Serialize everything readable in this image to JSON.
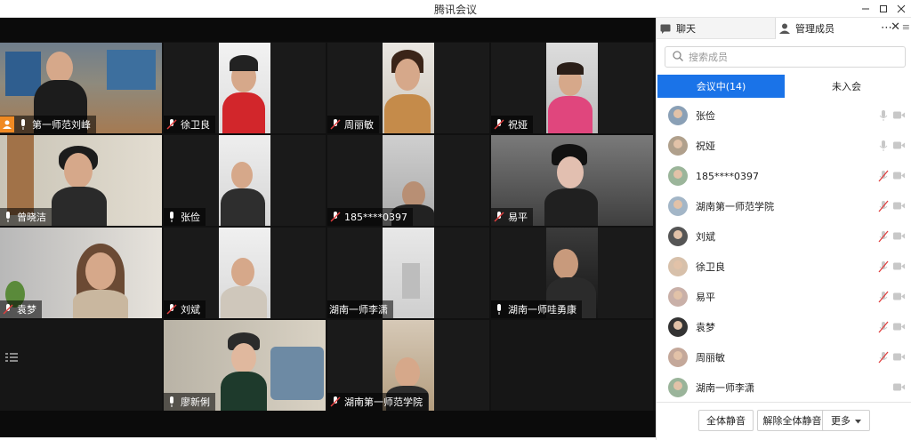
{
  "window": {
    "title": "腾讯会议"
  },
  "video_grid": {
    "tiles": [
      {
        "name": "第一师范刘峰",
        "host": true,
        "mic": "on"
      },
      {
        "name": "徐卫良",
        "mic": "muted"
      },
      {
        "name": "周丽敏",
        "mic": "muted"
      },
      {
        "name": "祝娅",
        "mic": "muted"
      },
      {
        "name": "曾晓洁",
        "mic": "on"
      },
      {
        "name": "张俭",
        "mic": "on"
      },
      {
        "name": "185****0397",
        "mic": "muted"
      },
      {
        "name": "易平",
        "mic": "muted"
      },
      {
        "name": "袁梦",
        "mic": "muted"
      },
      {
        "name": "刘斌",
        "mic": "muted"
      },
      {
        "name": "湖南一师李潇",
        "mic": "none"
      },
      {
        "name": "湖南一师哇勇康",
        "mic": "on"
      },
      {
        "name": "廖新俐",
        "mic": "on"
      },
      {
        "name": "湖南第一师范学院",
        "mic": "muted"
      }
    ]
  },
  "panel": {
    "tabs": {
      "chat": "聊天",
      "members": "管理成员"
    },
    "search_placeholder": "搜索成员",
    "segments": {
      "in_meeting": "会议中(14)",
      "not_joined": "未入会"
    },
    "members": [
      {
        "name": "张俭",
        "mic": "on"
      },
      {
        "name": "祝娅",
        "mic": "on"
      },
      {
        "name": "185****0397",
        "mic": "muted"
      },
      {
        "name": "湖南第一师范学院",
        "mic": "muted"
      },
      {
        "name": "刘斌",
        "mic": "muted"
      },
      {
        "name": "徐卫良",
        "mic": "muted"
      },
      {
        "name": "易平",
        "mic": "muted"
      },
      {
        "name": "袁梦",
        "mic": "muted"
      },
      {
        "name": "周丽敏",
        "mic": "muted"
      },
      {
        "name": "湖南一师李潇",
        "mic": "none"
      }
    ],
    "footer": {
      "mute_all": "全体静音",
      "unmute_all": "解除全体静音",
      "more": "更多"
    }
  },
  "colors": {
    "accent": "#1a73e8",
    "host_badge": "#f08a23",
    "muted_red": "#e03e3e"
  }
}
